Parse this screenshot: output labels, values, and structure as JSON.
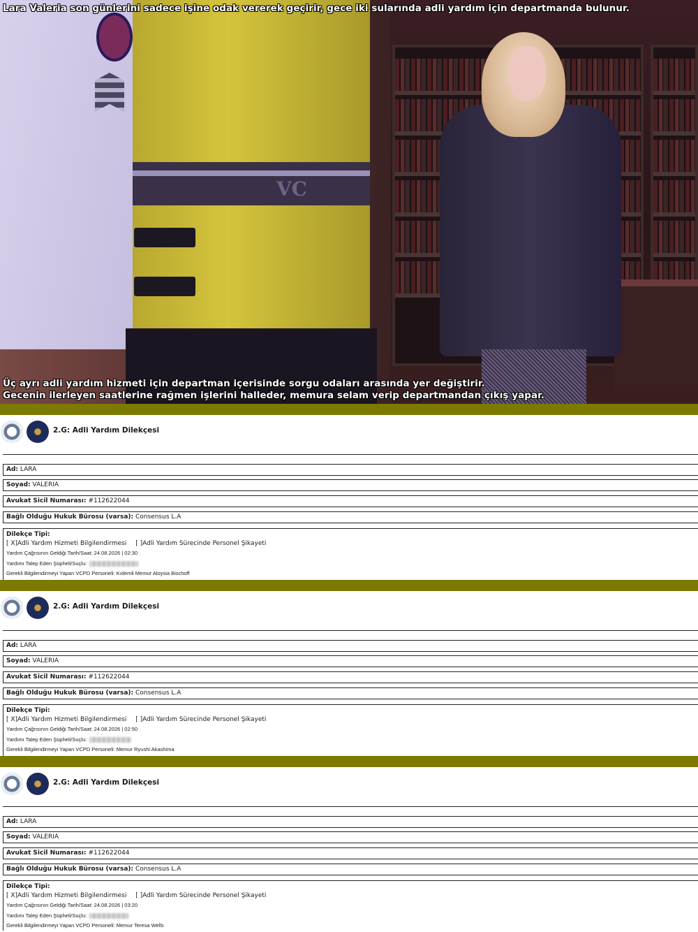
{
  "scene": {
    "caption_top": "Lara Valeria son günlerini sadece işine odak vererek geçirir, gece iki sularında adli yardım için departmanda bulunur.",
    "caption_bottom_1": "Üç ayrı adli yardım hizmeti için departman içerisinde sorgu odaları arasında yer değiştirir.",
    "caption_bottom_2": "Gecenin ilerleyen saatlerine rağmen işlerini halleder, memura selam verip departmandan çıkış yapar.",
    "vest_text": "VC"
  },
  "colors": {
    "separator": "#7c7a00",
    "caption": "#ffffff"
  },
  "forms": [
    {
      "title": "2.G: Adli Yardım Dilekçesi",
      "ad_label": "Ad:",
      "ad": "LARA",
      "soyad_label": "Soyad:",
      "soyad": "VALERIA",
      "sicil_label": "Avukat Sicil Numarası:",
      "sicil": "#112622044",
      "buro_label": "Bağlı Olduğu Hukuk Bürosu (varsa):",
      "buro": "Consensus L.A",
      "tip_label": "Dilekçe Tipi:",
      "opt1": "[ X]Adli Yardım Hizmeti Bilgilendirmesi",
      "opt2": "[ ]Adli Yardım Sürecinde Personel Şikayeti",
      "tarih_label": "Yardım Çağrısının Geldiği Tarih/Saat:",
      "tarih": "24.08.2026 | 02:30",
      "supheli_label": "Yardımı Talep Eden Şüpheli/Suçlu:",
      "personel_label": "Gerekli Bilgilendirmeyi Yapan VCPD Personeli:",
      "personel": "Kıdemli Memur Aloysia Bischoff"
    },
    {
      "title": "2.G: Adli Yardım Dilekçesi",
      "ad_label": "Ad:",
      "ad": "LARA",
      "soyad_label": "Soyad:",
      "soyad": "VALERIA",
      "sicil_label": "Avukat Sicil Numarası:",
      "sicil": "#112622044",
      "buro_label": "Bağlı Olduğu Hukuk Bürosu (varsa):",
      "buro": "Consensus L.A",
      "tip_label": "Dilekçe Tipi:",
      "opt1": "[ X]Adli Yardım Hizmeti Bilgilendirmesi",
      "opt2": "[ ]Adli Yardım Sürecinde Personel Şikayeti",
      "tarih_label": "Yardım Çağrısının Geldiği Tarih/Saat:",
      "tarih": "24.08.2026 | 02:50",
      "supheli_label": "Yardımı Talep Eden Şüpheli/Suçlu:",
      "personel_label": "Gerekli Bilgilendirmeyi Yapan VCPD Personeli:",
      "personel": "Memur Ryushi Akashima"
    },
    {
      "title": "2.G: Adli Yardım Dilekçesi",
      "ad_label": "Ad:",
      "ad": "LARA",
      "soyad_label": "Soyad:",
      "soyad": "VALERIA",
      "sicil_label": "Avukat Sicil Numarası:",
      "sicil": "#112622044",
      "buro_label": "Bağlı Olduğu Hukuk Bürosu (varsa):",
      "buro": "Consensus L.A",
      "tip_label": "Dilekçe Tipi:",
      "opt1": "[ X]Adli Yardım Hizmeti Bilgilendirmesi",
      "opt2": "[ ]Adli Yardım Sürecinde Personel Şikayeti",
      "tarih_label": "Yardım Çağrısının Geldiği Tarih/Saat:",
      "tarih": "24.08.2026 | 03:20",
      "supheli_label": "Yardımı Talep Eden Şüpheli/Suçlu:",
      "personel_label": "Gerekli Bilgilendirmeyi Yapan VCPD Personeli:",
      "personel": "Memur Teresa Wells"
    }
  ]
}
